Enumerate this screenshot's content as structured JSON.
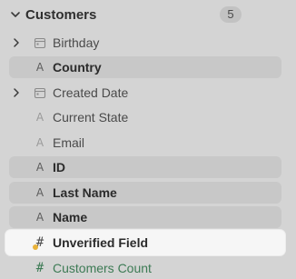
{
  "group": {
    "title": "Customers",
    "count": "5",
    "icon": "chevron-down-icon"
  },
  "fields": [
    {
      "label": "Birthday",
      "icon": "calendar-icon",
      "expandable": true
    },
    {
      "label": "Country",
      "icon": "text-attribute-icon",
      "expandable": false
    },
    {
      "label": "Created Date",
      "icon": "calendar-icon",
      "expandable": true
    },
    {
      "label": "Current State",
      "icon": "text-attribute-icon",
      "expandable": false
    },
    {
      "label": "Email",
      "icon": "text-attribute-icon",
      "expandable": false
    },
    {
      "label": "ID",
      "icon": "text-attribute-icon",
      "expandable": false
    },
    {
      "label": "Last Name",
      "icon": "text-attribute-icon",
      "expandable": false
    },
    {
      "label": "Name",
      "icon": "text-attribute-icon",
      "expandable": false
    },
    {
      "label": "Unverified Field",
      "icon": "number-hash-icon",
      "expandable": false,
      "warning": true
    },
    {
      "label": "Customers Count",
      "icon": "number-hash-icon",
      "expandable": false
    }
  ],
  "colors": {
    "background": "#d4d4d4",
    "highlight_row": "#c8c8c8",
    "selected_row": "#f6f6f6",
    "measure_green": "#3d7b55",
    "warning": "#e8b23a"
  }
}
